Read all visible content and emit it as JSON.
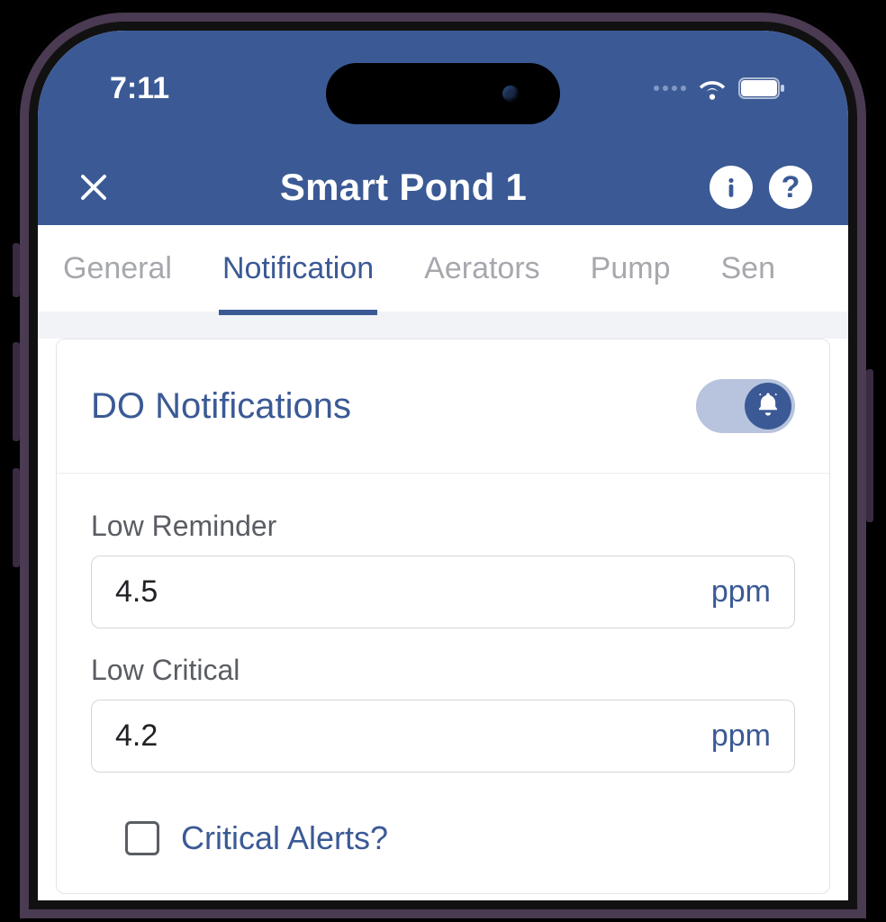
{
  "status": {
    "time": "7:11"
  },
  "header": {
    "title": "Smart Pond 1"
  },
  "tabs": {
    "items": [
      "General",
      "Notification",
      "Aerators",
      "Pump",
      "Sen"
    ],
    "activeIndex": 1
  },
  "section": {
    "title": "DO Notifications",
    "toggle_on": true,
    "fields": {
      "low_reminder": {
        "label": "Low Reminder",
        "value": "4.5",
        "unit": "ppm"
      },
      "low_critical": {
        "label": "Low Critical",
        "value": "4.2",
        "unit": "ppm"
      }
    },
    "critical_alerts": {
      "label": "Critical Alerts?",
      "checked": false
    }
  },
  "colors": {
    "primary": "#3b5a95"
  }
}
